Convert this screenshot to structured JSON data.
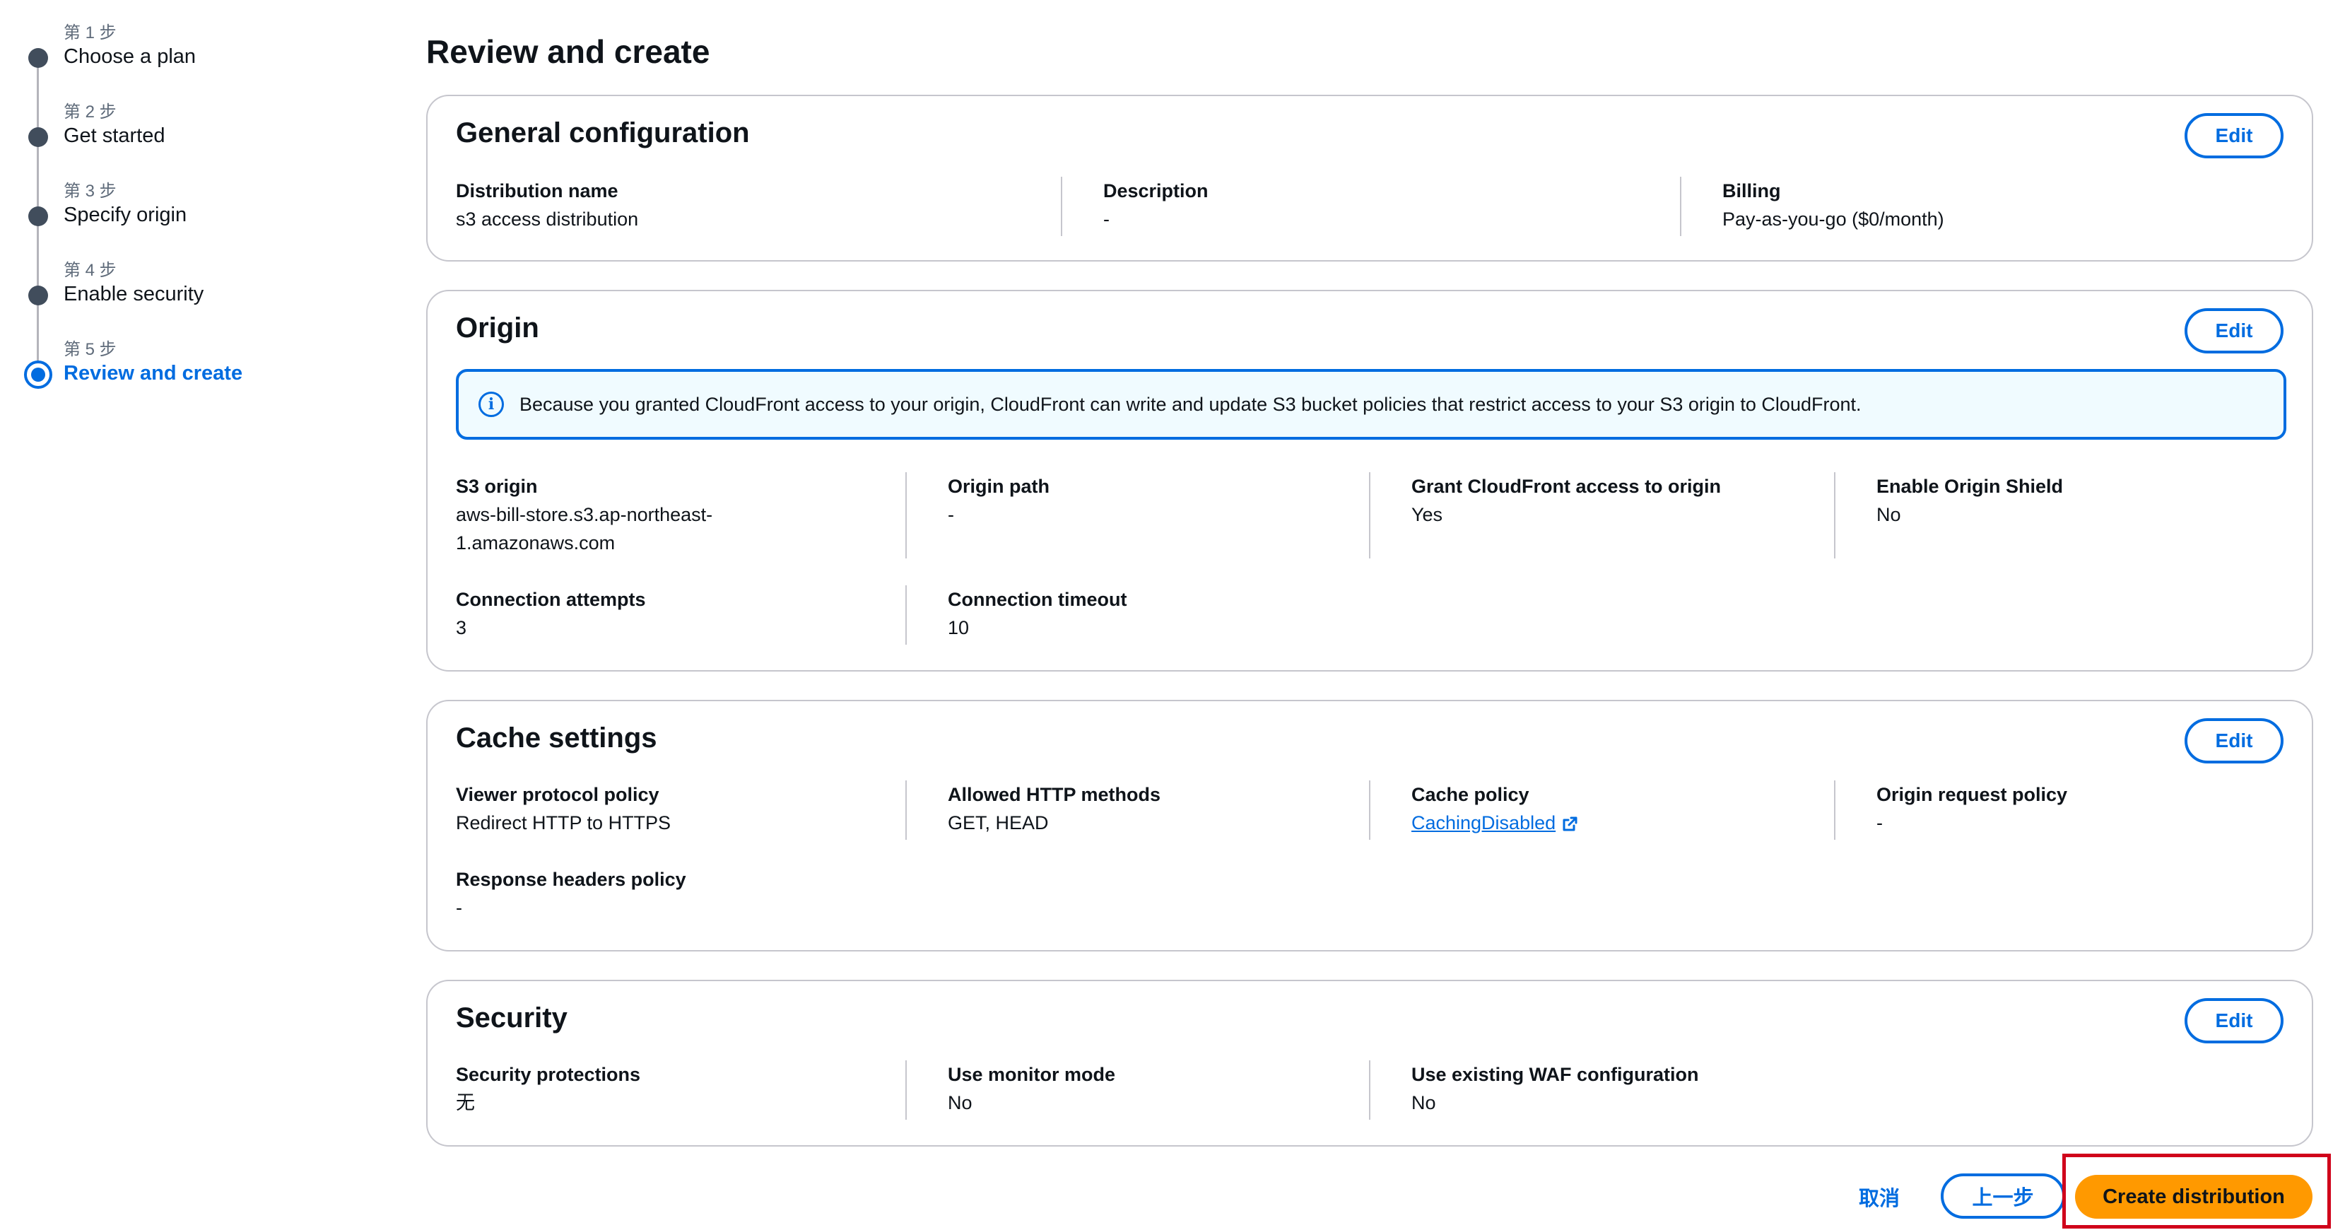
{
  "steps": [
    {
      "num": "第 1 步",
      "label": "Choose a plan"
    },
    {
      "num": "第 2 步",
      "label": "Get started"
    },
    {
      "num": "第 3 步",
      "label": "Specify origin"
    },
    {
      "num": "第 4 步",
      "label": "Enable security"
    },
    {
      "num": "第 5 步",
      "label": "Review and create"
    }
  ],
  "page_title": "Review and create",
  "edit_label": "Edit",
  "general": {
    "title": "General configuration",
    "distribution_name": {
      "label": "Distribution name",
      "value": "s3 access distribution"
    },
    "description": {
      "label": "Description",
      "value": "-"
    },
    "billing": {
      "label": "Billing",
      "value": "Pay-as-you-go ($0/month)"
    }
  },
  "origin": {
    "title": "Origin",
    "info": "Because you granted CloudFront access to your origin, CloudFront can write and update S3 bucket policies that restrict access to your S3 origin to CloudFront.",
    "s3_origin": {
      "label": "S3 origin",
      "value_line1": "aws-bill-store.s3.ap-northeast-",
      "value_line2": "1.amazonaws.com"
    },
    "origin_path": {
      "label": "Origin path",
      "value": "-"
    },
    "grant_access": {
      "label": "Grant CloudFront access to origin",
      "value": "Yes"
    },
    "origin_shield": {
      "label": "Enable Origin Shield",
      "value": "No"
    },
    "connection_attempts": {
      "label": "Connection attempts",
      "value": "3"
    },
    "connection_timeout": {
      "label": "Connection timeout",
      "value": "10"
    }
  },
  "cache": {
    "title": "Cache settings",
    "viewer_protocol": {
      "label": "Viewer protocol policy",
      "value": "Redirect HTTP to HTTPS"
    },
    "allowed_methods": {
      "label": "Allowed HTTP methods",
      "value": "GET, HEAD"
    },
    "cache_policy": {
      "label": "Cache policy",
      "value": "CachingDisabled"
    },
    "origin_request": {
      "label": "Origin request policy",
      "value": "-"
    },
    "response_headers": {
      "label": "Response headers policy",
      "value": "-"
    }
  },
  "security": {
    "title": "Security",
    "protections": {
      "label": "Security protections",
      "value": "无"
    },
    "monitor_mode": {
      "label": "Use monitor mode",
      "value": "No"
    },
    "existing_waf": {
      "label": "Use existing WAF configuration",
      "value": "No"
    }
  },
  "footer": {
    "cancel": "取消",
    "previous": "上一步",
    "create": "Create distribution"
  },
  "colors": {
    "accent": "#006ce0",
    "primary_button": "#ff9900",
    "highlight": "#d0021b"
  }
}
